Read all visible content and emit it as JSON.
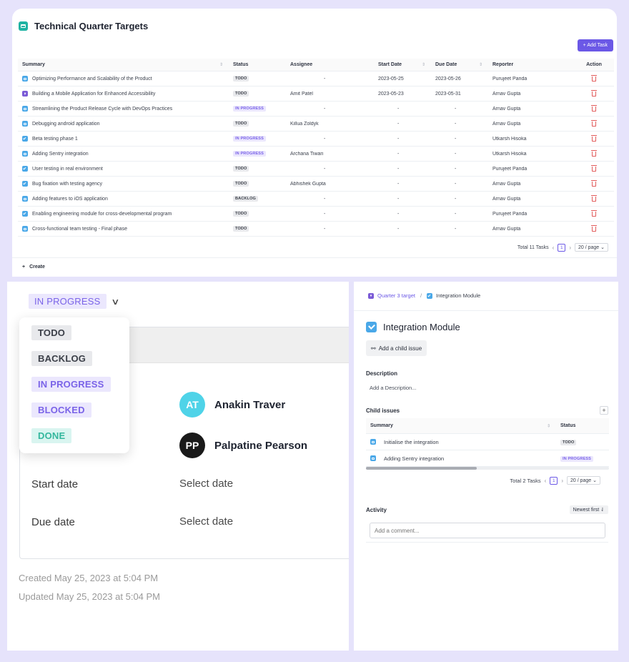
{
  "header": {
    "title": "Technical Quarter Targets",
    "add_task_label": "+ Add Task"
  },
  "table": {
    "columns": {
      "summary": "Summary",
      "status": "Status",
      "assignee": "Assignee",
      "start_date": "Start Date",
      "due_date": "Due Date",
      "reporter": "Reporter",
      "action": "Action"
    },
    "rows": [
      {
        "summary": "Optimizing Performance and Scalability of the Product",
        "icon": "task",
        "status": "TODO",
        "assignee": "-",
        "start": "2023-05-25",
        "due": "2023-05-26",
        "reporter": "Purujeet Parida"
      },
      {
        "summary": "Building a Mobile Application for Enhanced Accessibility",
        "icon": "epic",
        "status": "TODO",
        "assignee": "Amit Patel",
        "start": "2023-05-23",
        "due": "2023-05-31",
        "reporter": "Arnav Gupta"
      },
      {
        "summary": "Streamlining the Product Release Cycle with DevOps Practices",
        "icon": "task",
        "status": "IN PROGRESS",
        "assignee": "-",
        "start": "-",
        "due": "-",
        "reporter": "Arnav Gupta"
      },
      {
        "summary": "Debugging android application",
        "icon": "task",
        "status": "TODO",
        "assignee": "Killua Zoldyk",
        "start": "-",
        "due": "-",
        "reporter": "Arnav Gupta"
      },
      {
        "summary": "Beta testing phase 1",
        "icon": "check",
        "status": "IN PROGRESS",
        "assignee": "-",
        "start": "-",
        "due": "-",
        "reporter": "Utkarsh Hisoka"
      },
      {
        "summary": "Adding Sentry integration",
        "icon": "task",
        "status": "IN PROGRESS",
        "assignee": "Archana Tiwari",
        "start": "-",
        "due": "-",
        "reporter": "Utkarsh Hisoka"
      },
      {
        "summary": "User testing in real environment",
        "icon": "check",
        "status": "TODO",
        "assignee": "-",
        "start": "-",
        "due": "-",
        "reporter": "Purujeet Parida"
      },
      {
        "summary": "Bug fixation with testing agency",
        "icon": "check",
        "status": "TODO",
        "assignee": "Abhishek Gupta",
        "start": "-",
        "due": "-",
        "reporter": "Arnav Gupta"
      },
      {
        "summary": "Adding features to iOS application",
        "icon": "task",
        "status": "BACKLOG",
        "assignee": "-",
        "start": "-",
        "due": "-",
        "reporter": "Arnav Gupta"
      },
      {
        "summary": "Enabling engineering module for cross-developmental program",
        "icon": "check",
        "status": "TODO",
        "assignee": "-",
        "start": "-",
        "due": "-",
        "reporter": "Purujeet Parida"
      },
      {
        "summary": "Cross-functional team testing - Final phase",
        "icon": "task",
        "status": "TODO",
        "assignee": "-",
        "start": "-",
        "due": "-",
        "reporter": "Arnav Gupta"
      }
    ]
  },
  "pagination": {
    "total": "Total 11 Tasks",
    "current": "1",
    "page_size": "20 / page"
  },
  "create_label": "Create",
  "detail": {
    "status_current": "IN PROGRESS",
    "status_options": [
      "TODO",
      "BACKLOG",
      "IN PROGRESS",
      "BLOCKED",
      "DONE"
    ],
    "people": [
      {
        "initials": "AT",
        "name": "Anakin Traver",
        "color": "#4fd3e8"
      },
      {
        "initials": "PP",
        "name": "Palpatine Pearson",
        "color": "#1a1a1a"
      }
    ],
    "start_label": "Start date",
    "start_value": "Select date",
    "due_label": "Due date",
    "due_value": "Select date",
    "created": "Created May 25, 2023 at 5:04 PM",
    "updated": "Updated May 25, 2023 at 5:04 PM"
  },
  "issue": {
    "breadcrumb_parent": "Quarter 3 target",
    "breadcrumb_sep": "/",
    "breadcrumb_current": "Integration Module",
    "title": "Integration Module",
    "add_child_label": "Add a child issue",
    "description_label": "Description",
    "description_placeholder": "Add a Description...",
    "child_issues_label": "Child issues",
    "child_columns": {
      "summary": "Summary",
      "status": "Status"
    },
    "children": [
      {
        "summary": "Initialise the integration",
        "status": "TODO"
      },
      {
        "summary": "Adding Sentry integration",
        "status": "IN PROGRESS"
      }
    ],
    "child_total": "Total 2 Tasks",
    "child_current": "1",
    "child_page_size": "20 / page",
    "activity_label": "Activity",
    "sort_label": "Newest first",
    "comment_placeholder": "Add a comment..."
  },
  "colors": {
    "accent": "#6b58e6",
    "todo_bg": "#e8e9ec",
    "progress_bg": "#ebe7fd",
    "done_bg": "#d9f5f0",
    "background": "#e6e3fb"
  }
}
